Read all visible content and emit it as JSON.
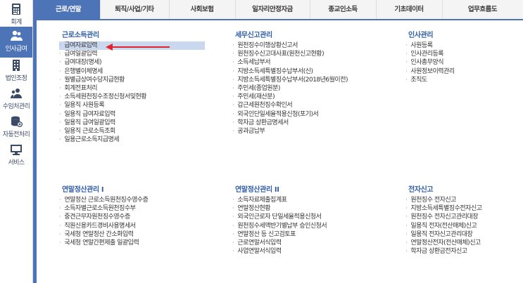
{
  "sidebar": {
    "items": [
      {
        "label": "회계",
        "icon": "calculator-icon"
      },
      {
        "label": "인사급여",
        "icon": "users-icon"
      },
      {
        "label": "법인조정",
        "icon": "building-icon"
      },
      {
        "label": "수임처관리",
        "icon": "clients-icon"
      },
      {
        "label": "자동전처리",
        "icon": "database-icon"
      },
      {
        "label": "서비스",
        "icon": "monitor-icon"
      }
    ],
    "active_index": 1
  },
  "tabs": [
    "근로/연말",
    "퇴직/사업/기타",
    "사회보험",
    "일자리안정자금",
    "종교인소득",
    "기초데이터",
    "업무흐름도"
  ],
  "colors": {
    "accent": "#4e74b8",
    "section_title": "#2f5ea8",
    "selected_row": "#c9d7ef",
    "arrow": "#e0262a"
  },
  "sections": {
    "s1": {
      "title": "근로소득관리",
      "items": [
        "급여자료입력",
        "급여일괄입력",
        "급여대장(명세)",
        "은행별이체명세",
        "월별급상여수당지급현황",
        "회계전표처리",
        "소득세원천징수조정신청서및현황",
        "일용직 사원등록",
        "일용직 급여자료입력",
        "일용직 급여일괄입력",
        "일용직 근로소득조회",
        "일용근로소득지급명세"
      ]
    },
    "s2": {
      "title": "세무신고관리",
      "items": [
        "원천징수이행상황신고서",
        "원천징수신고대사표(원천신고현황)",
        "소득세납부서",
        "지방소득세특별징수납부서(신)",
        "지방소득세특별징수납부서(2018년6월이전)",
        "주민세(종업원분)",
        "주민세(재산분)",
        "갑근세원천징수확인서",
        "외국인단일세율적용신청(포기)서",
        "학자금 상환금명세서",
        "공과금납부"
      ]
    },
    "s3": {
      "title": "인사관리",
      "items": [
        "사원등록",
        "인사관리등록",
        "인사총무양식",
        "사원정보이력관리",
        "조직도"
      ]
    },
    "s4": {
      "title": "연말정산관리 I",
      "items": [
        "연말정산 근로소득원천징수영수증",
        "소득자별근로소득원천징수부",
        "중견근무자원천징수영수증",
        "직원신용카드경비사용명세서",
        "국세청 연말정산 간소화입력",
        "국세청 연말간편제출 일괄입력"
      ]
    },
    "s5": {
      "title": "연말정산관리 II",
      "items": [
        "소득자료제출집계표",
        "연말정산현황",
        "외국인근로자 단일세율적용신청서",
        "원천징수세액반기별납부 승인신청서",
        "연말정산 등 신고검토표",
        "근로연말서식입력",
        "사업연말서식입력"
      ]
    },
    "s6": {
      "title": "전자신고",
      "items": [
        "원천징수 전자신고",
        "지방소득세특별징수전자신고",
        "원천징수 전자신고관리대장",
        "일용직 전자(전산매체)신고",
        "일용직 전자신고관리대장",
        "연말정산전자(전산매체)신고",
        "학자금 상환금전자신고"
      ]
    }
  },
  "selected_item": "급여자료입력"
}
